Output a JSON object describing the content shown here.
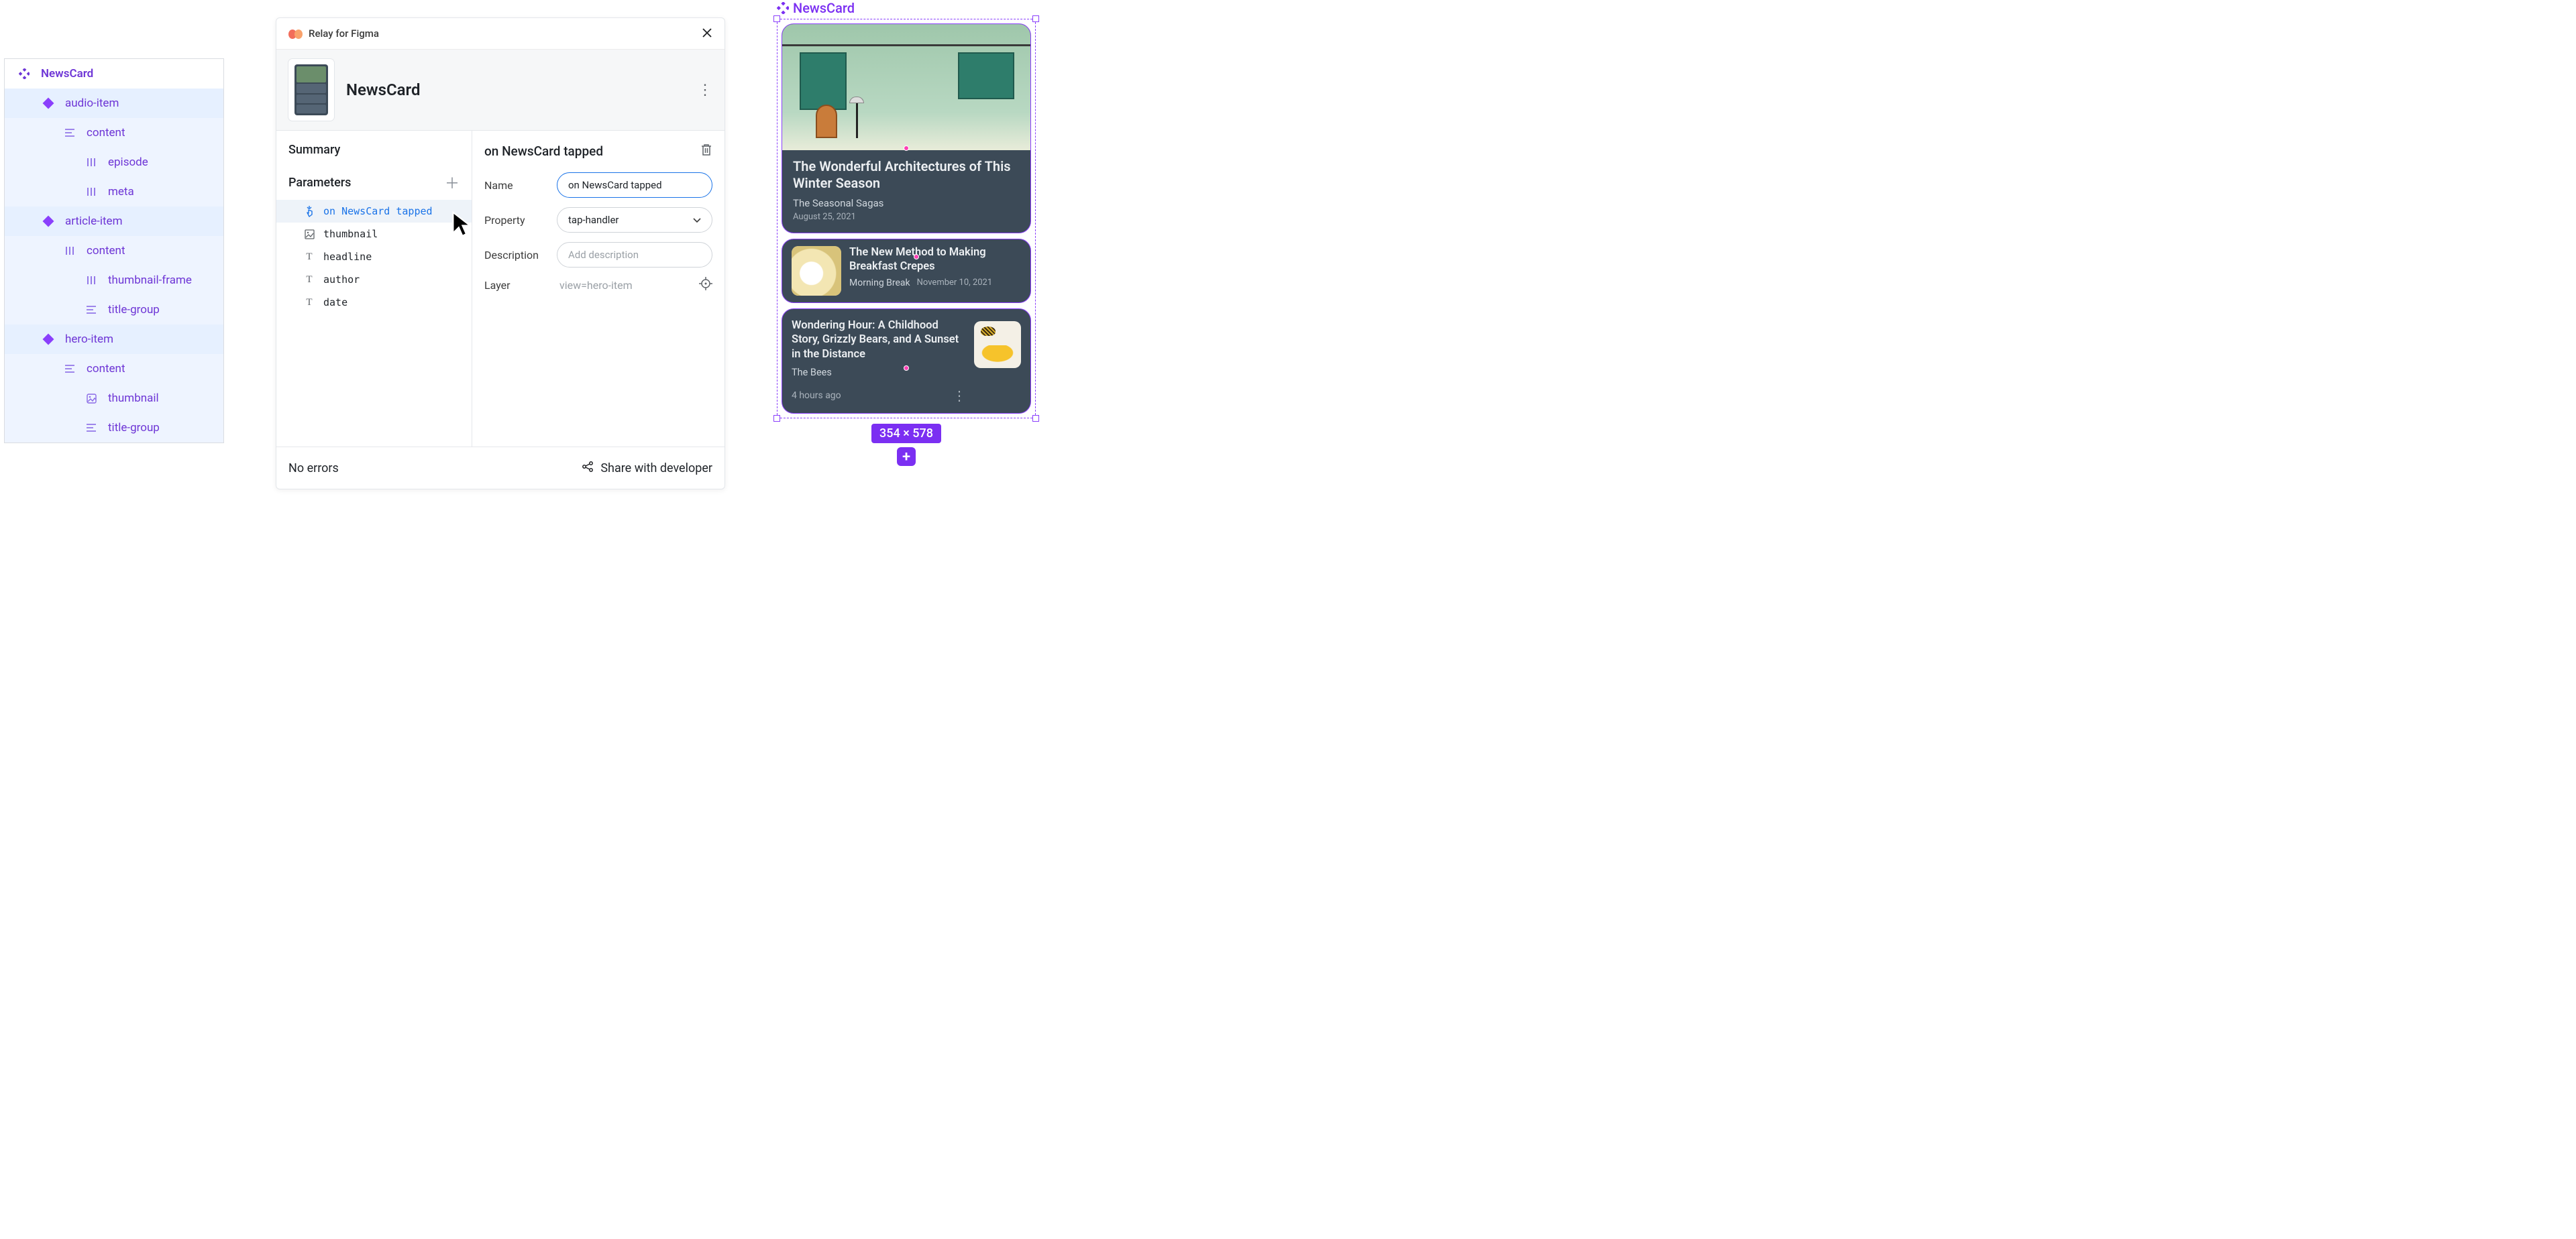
{
  "layerTree": {
    "root": "NewsCard",
    "items": [
      {
        "label": "audio-item",
        "icon": "diamond",
        "indent": 1,
        "sel": true
      },
      {
        "label": "content",
        "icon": "lines",
        "indent": 2,
        "sel": false
      },
      {
        "label": "episode",
        "icon": "bars",
        "indent": 3,
        "sel": false
      },
      {
        "label": "meta",
        "icon": "bars",
        "indent": 3,
        "sel": false
      },
      {
        "label": "article-item",
        "icon": "diamond",
        "indent": 1,
        "sel": true
      },
      {
        "label": "content",
        "icon": "bars",
        "indent": 2,
        "sel": false
      },
      {
        "label": "thumbnail-frame",
        "icon": "bars",
        "indent": 3,
        "sel": false
      },
      {
        "label": "title-group",
        "icon": "lines",
        "indent": 3,
        "sel": false
      },
      {
        "label": "hero-item",
        "icon": "diamond",
        "indent": 1,
        "sel": true
      },
      {
        "label": "content",
        "icon": "lines",
        "indent": 2,
        "sel": false
      },
      {
        "label": "thumbnail",
        "icon": "image",
        "indent": 3,
        "sel": false
      },
      {
        "label": "title-group",
        "icon": "lines",
        "indent": 3,
        "sel": false
      }
    ]
  },
  "plugin": {
    "title": "Relay for Figma",
    "componentName": "NewsCard",
    "summaryLabel": "Summary",
    "parametersLabel": "Parameters",
    "params": [
      {
        "name": "on NewsCard tapped",
        "icon": "tap",
        "selected": true
      },
      {
        "name": "thumbnail",
        "icon": "image",
        "selected": false
      },
      {
        "name": "headline",
        "icon": "T",
        "selected": false
      },
      {
        "name": "author",
        "icon": "T",
        "selected": false
      },
      {
        "name": "date",
        "icon": "T",
        "selected": false
      }
    ],
    "right": {
      "heading": "on NewsCard tapped",
      "nameLabel": "Name",
      "nameValue": "on NewsCard tapped",
      "propertyLabel": "Property",
      "propertyValue": "tap-handler",
      "descriptionLabel": "Description",
      "descriptionPlaceholder": "Add description",
      "layerLabel": "Layer",
      "layerValue": "view=hero-item"
    },
    "footer": {
      "status": "No errors",
      "share": "Share with developer"
    }
  },
  "canvas": {
    "labelName": "NewsCard",
    "hero": {
      "headline": "The Wonderful Architectures of This Winter Season",
      "source": "The Seasonal Sagas",
      "date": "August 25, 2021"
    },
    "article": {
      "headline": "The New Method to Making Breakfast Crepes",
      "source": "Morning Break",
      "date": "November 10, 2021"
    },
    "audio": {
      "headline": "Wondering Hour: A Childhood Story, Grizzly Bears, and A Sunset in the Distance",
      "source": "The Bees",
      "time": "4 hours ago"
    },
    "dimensions": "354 × 578"
  }
}
